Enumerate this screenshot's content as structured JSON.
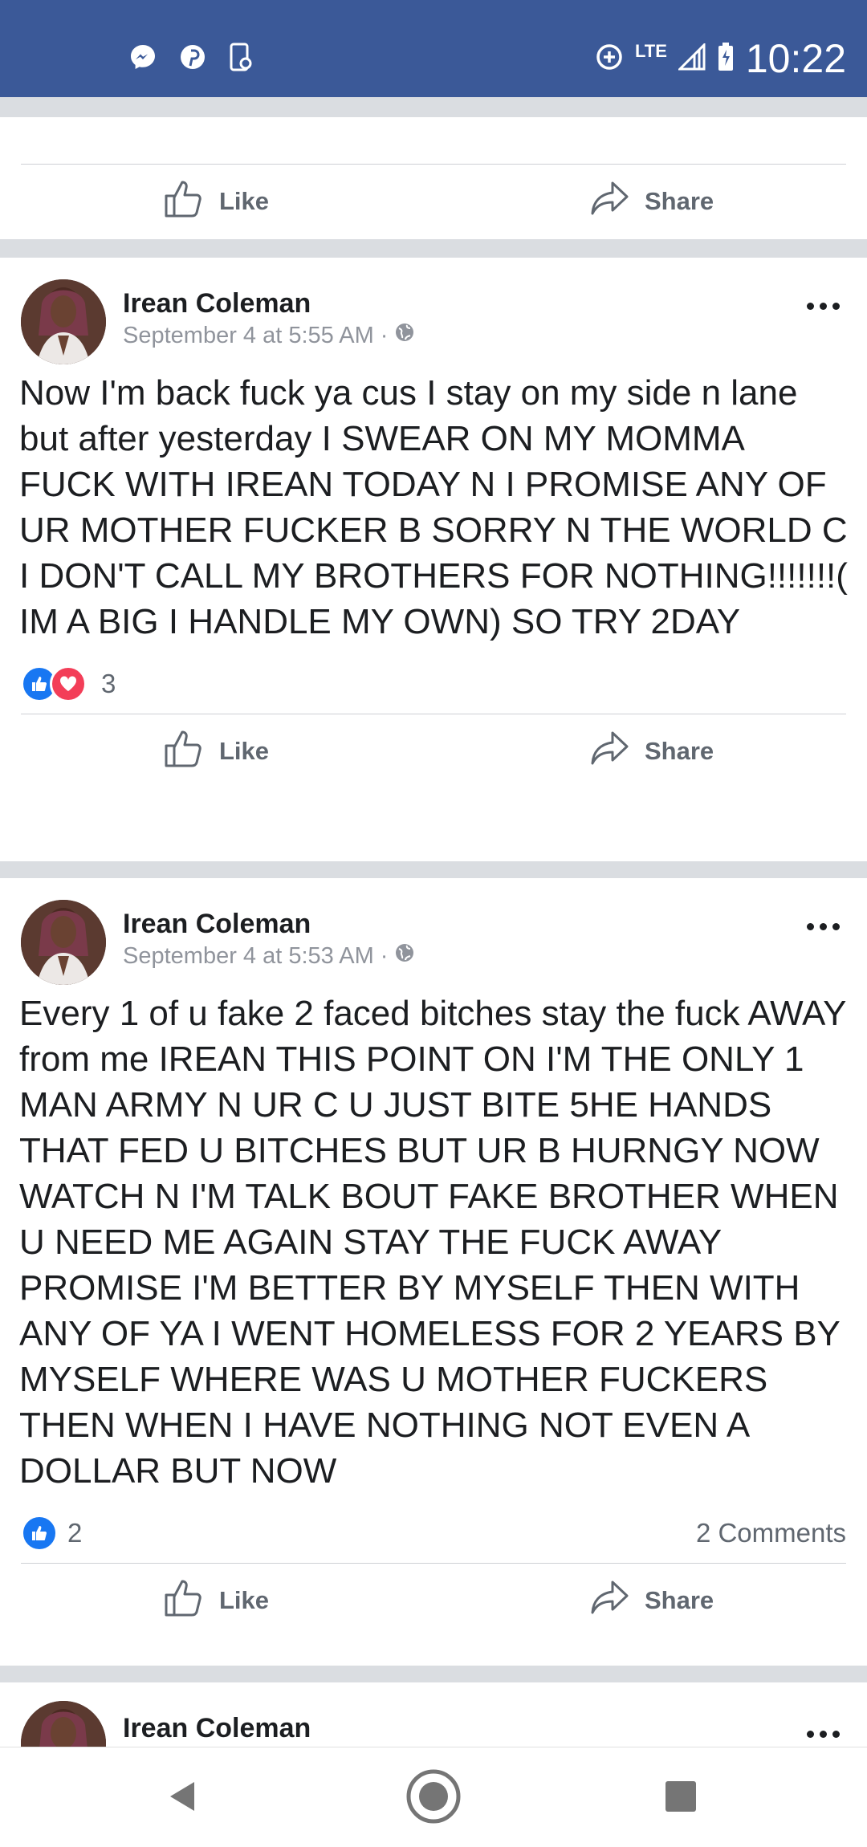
{
  "status_bar": {
    "time": "10:22",
    "network": "LTE",
    "left_icons": [
      "messenger-icon",
      "pinterest-icon",
      "phone-screen-icon"
    ],
    "right_icons": [
      "data-saver-icon",
      "signal-icon",
      "battery-icon"
    ]
  },
  "actions": {
    "like": "Like",
    "share": "Share"
  },
  "posts": [
    {
      "author": "Irean Coleman",
      "timestamp": "September 4 at 5:55 AM",
      "text": "Now I'm back fuck ya cus I stay on my side n lane but after yesterday I SWEAR ON MY MOMMA FUCK WITH IREAN TODAY N I PROMISE ANY OF UR MOTHER FUCKER B SORRY N THE WORLD C I DON'T CALL MY BROTHERS FOR NOTHING!!!!!!!( IM A BIG I HANDLE MY OWN) SO TRY 2DAY",
      "reaction_count": "3",
      "reactions": [
        "like",
        "love"
      ]
    },
    {
      "author": "Irean Coleman",
      "timestamp": "September 4 at 5:53 AM",
      "text": "Every 1 of u fake 2 faced bitches stay the fuck AWAY from me IREAN THIS POINT ON I'M THE ONLY 1 MAN ARMY N UR C U JUST BITE 5HE HANDS THAT FED U BITCHES BUT UR B HURNGY NOW WATCH N I'M TALK BOUT FAKE BROTHER WHEN U NEED ME AGAIN STAY THE FUCK AWAY PROMISE I'M BETTER BY MYSELF THEN WITH ANY OF YA I WENT HOMELESS FOR 2 YEARS BY MYSELF WHERE WAS U MOTHER FUCKERS THEN WHEN I HAVE NOTHING NOT EVEN A DOLLAR BUT NOW",
      "reaction_count": "2",
      "reactions": [
        "like"
      ],
      "comments": "2 Comments"
    },
    {
      "author": "Irean Coleman"
    }
  ],
  "nav": {
    "icons": [
      "back-icon",
      "home-icon",
      "recents-icon"
    ]
  },
  "colors": {
    "header": "#3b5998",
    "like_blue": "#1877f2",
    "love_red": "#f33e58",
    "text_gray": "#606770"
  }
}
